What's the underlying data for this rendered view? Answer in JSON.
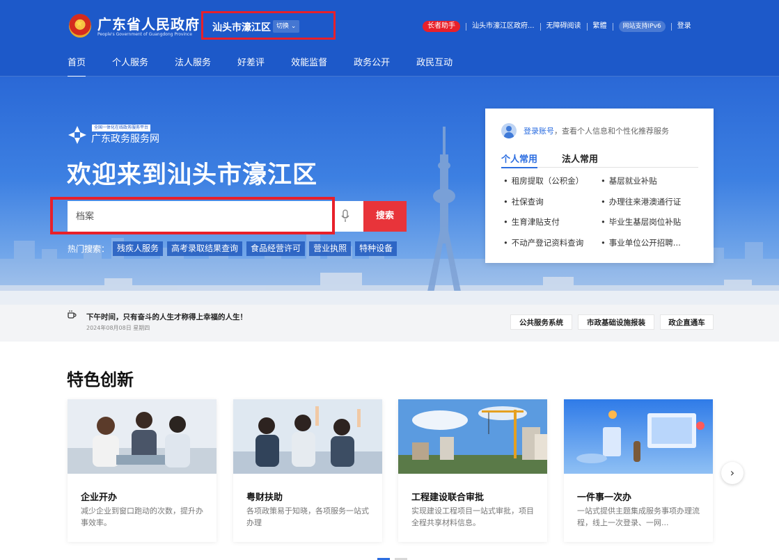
{
  "header": {
    "gov_title": "广东省人民政府",
    "gov_subtitle": "People's Government of Guangdong Province",
    "region_name": "汕头市濠江区",
    "switch_label": "切换",
    "elder_label": "长者助手",
    "gov_site_label": "汕头市濠江区政府...",
    "accessible_label": "无障碍阅读",
    "traditional_label": "繁體",
    "ipv6_label": "网站支持IPv6",
    "login_label": "登录"
  },
  "nav": {
    "items": [
      "首页",
      "个人服务",
      "法人服务",
      "好差评",
      "效能监督",
      "政务公开",
      "政民互动"
    ],
    "active_index": 0
  },
  "hero": {
    "platform_tag": "全国一体化在线政务服务平台",
    "platform_name": "广东政务服务网",
    "welcome": "欢迎来到汕头市濠江区",
    "search_placeholder": "档案",
    "search_button": "搜索",
    "hot_label": "热门搜索：",
    "hot_tags": [
      "残疾人服务",
      "高考录取结果查询",
      "食品经营许可",
      "营业执照",
      "特种设备"
    ]
  },
  "login_card": {
    "login_link": "登录账号",
    "login_hint": "，查看个人信息和个性化推荐服务",
    "tabs": [
      "个人常用",
      "法人常用"
    ],
    "active_tab": 0,
    "items": [
      "租房提取（公积金）",
      "基层就业补贴",
      "社保查询",
      "办理往来港澳通行证",
      "生育津贴支付",
      "毕业生基层岗位补贴",
      "不动产登记资料查询",
      "事业单位公开招聘..."
    ]
  },
  "notice": {
    "text": "下午时间，只有奋斗的人生才称得上幸福的人生！",
    "date": "2024年08月08日 星期四",
    "quick_links": [
      "公共服务系统",
      "市政基础设施报装",
      "政企直通车"
    ]
  },
  "features": {
    "title": "特色创新",
    "cards": [
      {
        "title": "企业开办",
        "desc": "减少企业到窗口跑动的次数，提升办事效率。"
      },
      {
        "title": "粤财扶助",
        "desc": "各项政策易于知晓，各项服务一站式办理"
      },
      {
        "title": "工程建设联合审批",
        "desc": "实现建设工程项目一站式审批，项目全程共享材料信息。"
      },
      {
        "title": "一件事一次办",
        "desc": "一站式提供主题集成服务事项办理流程，线上一次登录、一网..."
      }
    ],
    "next_icon": "chevron-right-icon"
  },
  "colors": {
    "brand_blue": "#1d59c9",
    "highlight_red": "#e8202a",
    "search_red": "#e8343a",
    "link_blue": "#2b6de0"
  }
}
